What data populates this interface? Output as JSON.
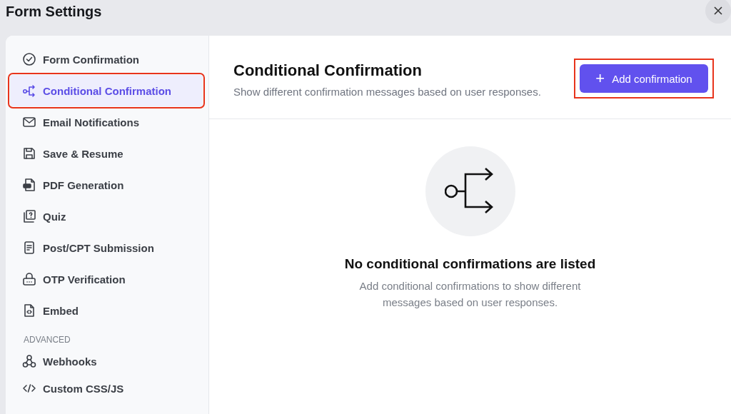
{
  "window": {
    "title": "Form Settings"
  },
  "sidebar": {
    "items": [
      {
        "label": "Form Confirmation",
        "kind": "check-circle",
        "selected": false,
        "annotated": false
      },
      {
        "label": "Conditional Confirmation",
        "kind": "branch",
        "selected": true,
        "annotated": true
      },
      {
        "label": "Email Notifications",
        "kind": "envelope",
        "selected": false,
        "annotated": false
      },
      {
        "label": "Save & Resume",
        "kind": "floppy",
        "selected": false,
        "annotated": false
      },
      {
        "label": "PDF Generation",
        "kind": "pdf",
        "selected": false,
        "annotated": false
      },
      {
        "label": "Quiz",
        "kind": "quiz",
        "selected": false,
        "annotated": false
      },
      {
        "label": "Post/CPT Submission",
        "kind": "document",
        "selected": false,
        "annotated": false
      },
      {
        "label": "OTP Verification",
        "kind": "lock",
        "selected": false,
        "annotated": false
      },
      {
        "label": "Embed",
        "kind": "code-file",
        "selected": false,
        "annotated": false
      }
    ],
    "section": {
      "heading": "ADVANCED",
      "items": [
        {
          "label": "Webhooks",
          "kind": "webhook",
          "selected": false,
          "annotated": false
        },
        {
          "label": "Custom CSS/JS",
          "kind": "code",
          "selected": false,
          "annotated": false
        }
      ]
    }
  },
  "header": {
    "title": "Conditional Confirmation",
    "subtitle": "Show different confirmation messages based on user responses.",
    "button": {
      "icon": "+",
      "label": "Add confirmation",
      "annotated": true
    }
  },
  "empty_state": {
    "title": "No conditional confirmations are listed",
    "message": "Add conditional confirmations to show different messages based on user responses."
  }
}
